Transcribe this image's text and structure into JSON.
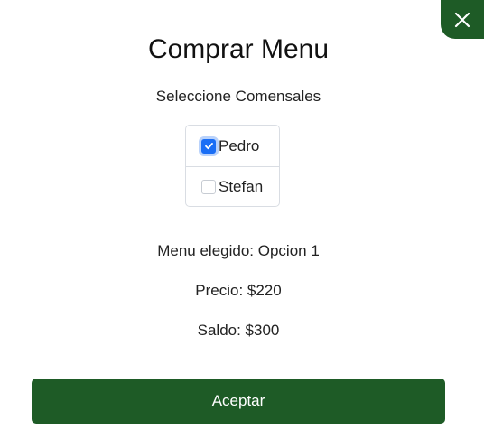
{
  "dialog": {
    "title": "Comprar Menu",
    "subtitle": "Seleccione Comensales"
  },
  "diners": [
    {
      "name": "Pedro",
      "checked": true
    },
    {
      "name": "Stefan",
      "checked": false
    }
  ],
  "summary": {
    "menu_text": "Menu elegido: Opcion 1",
    "price_text": "Precio: $220",
    "balance_text": "Saldo: $300"
  },
  "actions": {
    "accept_label": "Aceptar",
    "close_icon": "close-icon"
  },
  "colors": {
    "primary_green": "#1e5b26",
    "checkbox_blue": "#1a6ef5"
  }
}
